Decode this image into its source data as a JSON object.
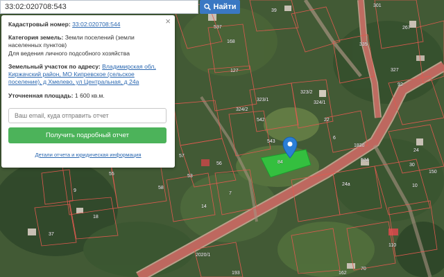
{
  "search": {
    "value": "33:02:020708:543",
    "button_label": "Найти"
  },
  "info_panel": {
    "close_symbol": "×",
    "cadastral_label": "Кадастровый номер:",
    "cadastral_value": "33:02:020708:544",
    "category_label": "Категория земель:",
    "category_value": "Земли поселений (земли населенных пунктов)",
    "usage_value": "Для ведения личного подсобного хозяйства",
    "address_label": "Земельный участок по адресу:",
    "address_value": "Владимирская обл, Киржачский район, МО Кипревское (сельское поселение), д Хмелево, ул Центральная, д 24а",
    "area_label": "Уточненная площадь:",
    "area_value": "1 600 кв.м.",
    "email_placeholder": "Ваш email, куда отправить отчет",
    "report_button": "Получить подробный отчет",
    "details_link": "Детали отчета и юридическая информация"
  },
  "map": {
    "parcel_labels": [
      "39",
      "301",
      "537",
      "168",
      "335",
      "267",
      "127",
      "327",
      "92",
      "323/2",
      "323/1",
      "324/2",
      "324/1",
      "542",
      "22",
      "543",
      "6",
      "534",
      "24",
      "56",
      "84",
      "57",
      "53",
      "7",
      "24а",
      "1830",
      "30",
      "150",
      "10",
      "9",
      "58",
      "14",
      "18",
      "37",
      "55",
      "110",
      "2020/1",
      "193",
      "162",
      "70"
    ],
    "colors": {
      "highlight": "#2ecc40",
      "road": "#c25a55",
      "boundary": "#e05a50",
      "marker": "#2b7fd6"
    }
  }
}
